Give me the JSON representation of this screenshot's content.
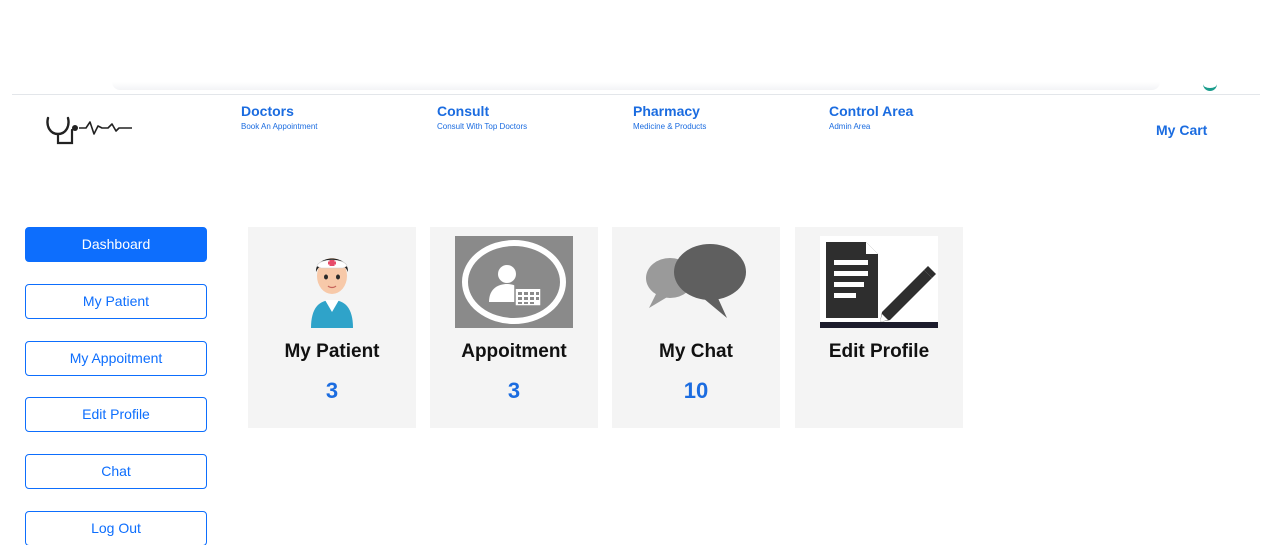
{
  "header": {
    "nav": [
      {
        "title": "Doctors",
        "subtitle": "Book An Appointment"
      },
      {
        "title": "Consult",
        "subtitle": "Consult With Top Doctors"
      },
      {
        "title": "Pharmacy",
        "subtitle": "Medicine & Products"
      },
      {
        "title": "Control Area",
        "subtitle": "Admin Area"
      }
    ],
    "cart_label": "My Cart",
    "logo_icon": "stethoscope-heartbeat-icon",
    "accent_color": "#1b6ce0"
  },
  "sidebar": {
    "items": [
      {
        "label": "Dashboard",
        "active": true
      },
      {
        "label": "My Patient",
        "active": false
      },
      {
        "label": "My Appoitment",
        "active": false
      },
      {
        "label": "Edit Profile",
        "active": false
      },
      {
        "label": "Chat",
        "active": false
      },
      {
        "label": "Log Out",
        "active": false
      }
    ],
    "button_color": "#0d6efd"
  },
  "cards": [
    {
      "title": "My Patient",
      "count": "3",
      "icon": "nurse-avatar-icon"
    },
    {
      "title": "Appoitment",
      "count": "3",
      "icon": "appointment-calendar-icon"
    },
    {
      "title": "My Chat",
      "count": "10",
      "icon": "chat-bubbles-icon"
    },
    {
      "title": "Edit Profile",
      "count": "",
      "icon": "edit-document-icon"
    }
  ]
}
